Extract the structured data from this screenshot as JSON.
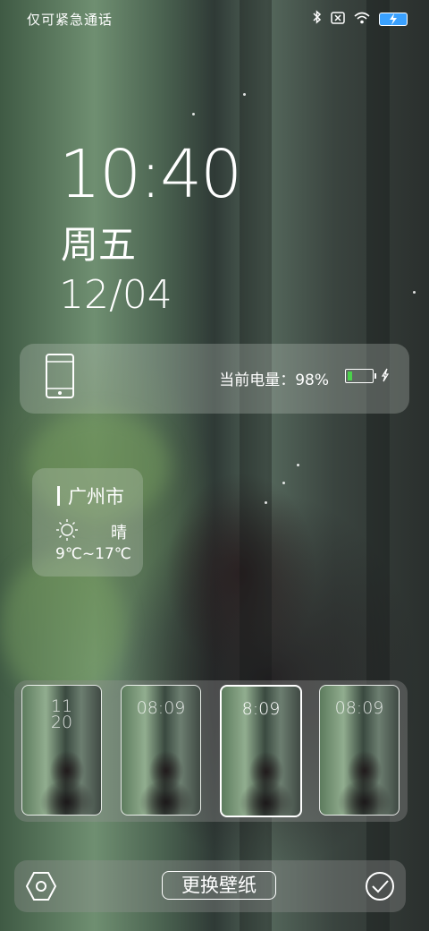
{
  "status_bar": {
    "carrier_text": "仅可紧急通话",
    "icons": [
      "bluetooth-icon",
      "no-sim-icon",
      "wifi-icon",
      "battery-charging-icon"
    ],
    "battery_color": "#3aa1ff"
  },
  "lockscreen": {
    "time": "10:40",
    "weekday": "周五",
    "date": "12/04"
  },
  "battery_widget": {
    "label": "当前电量：98%",
    "level_percent": 98,
    "fill_color": "#4bd14b",
    "icons": [
      "phone-icon",
      "battery-icon",
      "charging-bolt-icon"
    ]
  },
  "weather_widget": {
    "city": "广州市",
    "condition": "晴",
    "temperature_range": "9℃~17℃",
    "icon": "sun-icon"
  },
  "wallpaper_thumbnails": [
    {
      "time": "11\n20",
      "selected": false
    },
    {
      "time": "08:09",
      "selected": false
    },
    {
      "time": "8:09",
      "selected": true
    },
    {
      "time": "08:09",
      "selected": false
    }
  ],
  "bottom_bar": {
    "change_wallpaper_label": "更换壁纸",
    "left_icon": "hexagon-settings-icon",
    "right_icon": "check-circle-icon"
  }
}
